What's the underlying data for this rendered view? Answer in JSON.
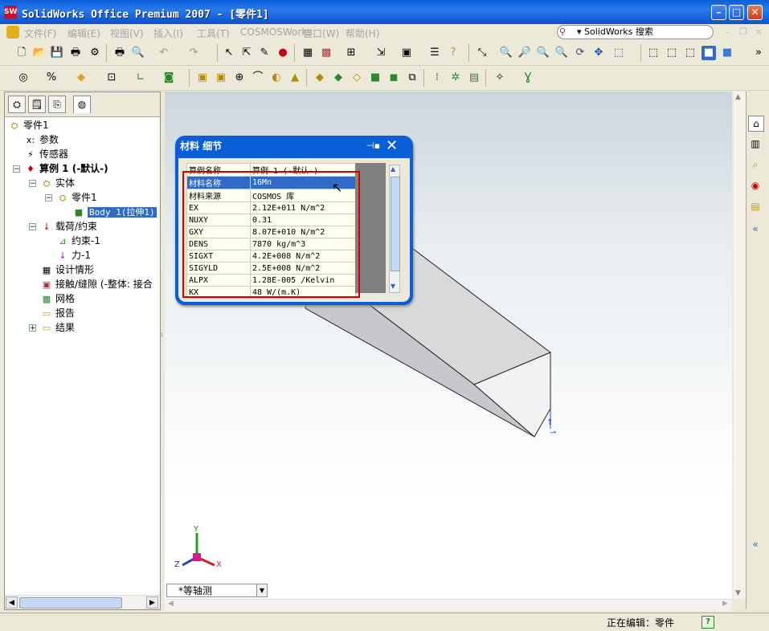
{
  "window": {
    "title": "SolidWorks Office Premium 2007 - [零件1]",
    "app_icon": "SW",
    "minimize": "–",
    "maximize": "□",
    "close": "✕"
  },
  "menu": {
    "items": [
      "文件(F)",
      "编辑(E)",
      "视图(V)",
      "插入(I)",
      "工具(T)",
      "COSMOSWorks",
      "窗口(W)",
      "帮助(H)"
    ],
    "search_label": "▾ SolidWorks 搜索",
    "mdi_min": "–",
    "mdi_restore": "❐",
    "mdi_close": "×"
  },
  "tree": {
    "root": "零件1",
    "items": [
      {
        "label": "参数"
      },
      {
        "label": "传感器"
      },
      {
        "label": "算例 1 (-默认-)"
      },
      {
        "label": "实体"
      },
      {
        "label": "零件1"
      },
      {
        "label": "Body 1(拉伸1)"
      },
      {
        "label": "载荷/约束"
      },
      {
        "label": "约束-1"
      },
      {
        "label": "力-1"
      },
      {
        "label": "设计情形"
      },
      {
        "label": "接触/缝隙 (-整体: 接合"
      },
      {
        "label": "网格"
      },
      {
        "label": "报告"
      },
      {
        "label": "结果"
      }
    ]
  },
  "dialog": {
    "title": "材料 细节",
    "pin": "⊣▪",
    "close": "✕",
    "rows": [
      {
        "key": "算例名称",
        "value": "算例 1 (-默认-)"
      },
      {
        "key": "材料名称",
        "value": "16Mn"
      },
      {
        "key": "材料来源",
        "value": "COSMOS 库"
      },
      {
        "key": "EX",
        "value": "2.12E+011   N/m^2"
      },
      {
        "key": "NUXY",
        "value": "0.31"
      },
      {
        "key": "GXY",
        "value": "8.07E+010   N/m^2"
      },
      {
        "key": "DENS",
        "value": "7870   kg/m^3"
      },
      {
        "key": "SIGXT",
        "value": "4.2E+008   N/m^2"
      },
      {
        "key": "SIGYLD",
        "value": "2.5E+008   N/m^2"
      },
      {
        "key": "ALPX",
        "value": "1.28E-005   /Kelvin"
      },
      {
        "key": "KX",
        "value": "48   W/(m.K)"
      }
    ],
    "selected_row": 1
  },
  "view": {
    "orientation": "*等轴测",
    "axis_x": "X",
    "axis_y": "Y",
    "axis_z": "Z"
  },
  "status": {
    "editing": "正在编辑：零件",
    "help": "?"
  },
  "colors": {
    "title_blue": "#0a5fd8",
    "selection_blue": "#316ac5",
    "highlight_red": "#d40000"
  }
}
